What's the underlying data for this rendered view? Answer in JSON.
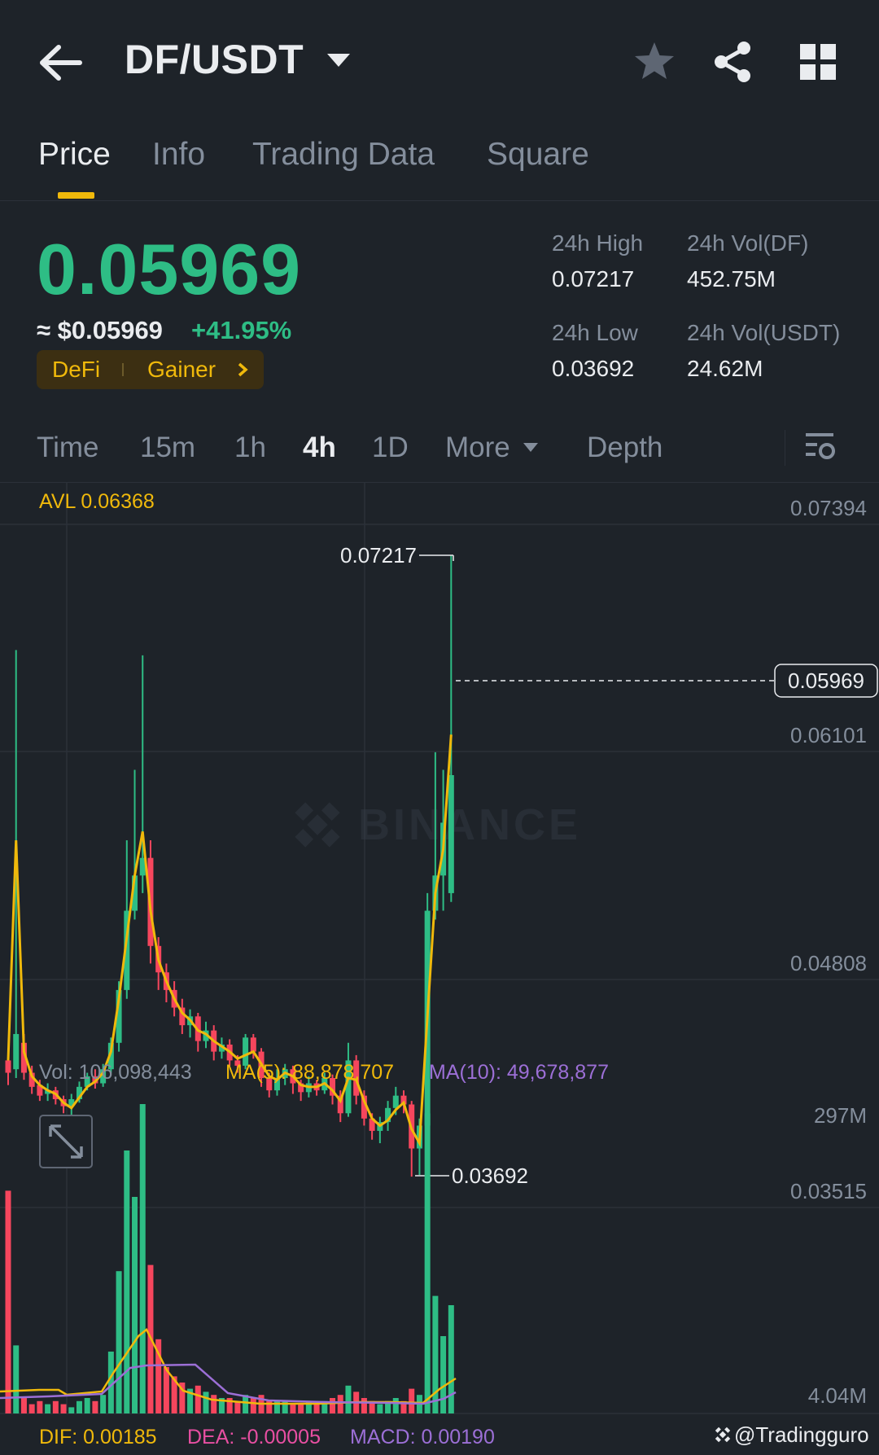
{
  "header": {
    "pair": "DF/USDT",
    "icons": [
      "back-arrow-icon",
      "star-icon",
      "share-icon",
      "grid-menu-icon"
    ]
  },
  "tabs": [
    {
      "label": "Price",
      "active": true
    },
    {
      "label": "Info",
      "active": false
    },
    {
      "label": "Trading Data",
      "active": false
    },
    {
      "label": "Square",
      "active": false
    }
  ],
  "price": {
    "last": "0.05969",
    "usd": "≈ $0.05969",
    "change": "+41.95%",
    "tag1": "DeFi",
    "tag2": "Gainer",
    "colors": {
      "up": "#2ebd85",
      "down": "#f6465d",
      "accent": "#f0b90b"
    }
  },
  "stats": {
    "high_label": "24h High",
    "high_value": "0.07217",
    "low_label": "24h Low",
    "low_value": "0.03692",
    "vol_df_label": "24h Vol(DF)",
    "vol_df_value": "452.75M",
    "vol_usdt_label": "24h Vol(USDT)",
    "vol_usdt_value": "24.62M"
  },
  "intervals": {
    "time": "Time",
    "m15": "15m",
    "h1": "1h",
    "h4": "4h",
    "d1": "1D",
    "more": "More",
    "depth": "Depth",
    "active": "4h"
  },
  "chart": {
    "avl": "AVL 0.06368",
    "y_ticks": [
      "0.07394",
      "0.06101",
      "0.04808",
      "0.03515"
    ],
    "current_price_tag": "0.05969",
    "high_marker": "0.07217",
    "low_marker": "0.03692",
    "watermark": "BINANCE",
    "vol_line": "Vol: 106,098,443",
    "ma5": "MA(5): 88,878,707",
    "ma10": "MA(10): 49,678,877",
    "vol_ticks": [
      "297M",
      "4.04M"
    ],
    "dif": "DIF: 0.00185",
    "dea": "DEA: -0.00005",
    "macd": "MACD: 0.00190",
    "credit": "@Tradingguro"
  },
  "chart_data": {
    "type": "candlestick",
    "interval": "4h",
    "y_axis_ticks": [
      0.07394,
      0.06101,
      0.04808,
      0.03515
    ],
    "ylim": [
      0.03515,
      0.07394
    ],
    "last_price": 0.05969,
    "high": 0.07217,
    "low": 0.03692,
    "candles": [
      {
        "o": 0.0435,
        "c": 0.0428,
        "h": 0.044,
        "l": 0.0421
      },
      {
        "o": 0.043,
        "c": 0.045,
        "h": 0.0668,
        "l": 0.0425
      },
      {
        "o": 0.0445,
        "c": 0.0428,
        "h": 0.045,
        "l": 0.0424
      },
      {
        "o": 0.0428,
        "c": 0.042,
        "h": 0.0432,
        "l": 0.0416
      },
      {
        "o": 0.0421,
        "c": 0.0415,
        "h": 0.0424,
        "l": 0.0412
      },
      {
        "o": 0.0416,
        "c": 0.0418,
        "h": 0.0422,
        "l": 0.0412
      },
      {
        "o": 0.0418,
        "c": 0.0413,
        "h": 0.042,
        "l": 0.041
      },
      {
        "o": 0.0413,
        "c": 0.0409,
        "h": 0.0415,
        "l": 0.0405
      },
      {
        "o": 0.0409,
        "c": 0.0413,
        "h": 0.0416,
        "l": 0.0404
      },
      {
        "o": 0.0413,
        "c": 0.042,
        "h": 0.0423,
        "l": 0.0411
      },
      {
        "o": 0.042,
        "c": 0.0426,
        "h": 0.0428,
        "l": 0.0418
      },
      {
        "o": 0.0426,
        "c": 0.0422,
        "h": 0.043,
        "l": 0.0419
      },
      {
        "o": 0.0422,
        "c": 0.043,
        "h": 0.0433,
        "l": 0.042
      },
      {
        "o": 0.043,
        "c": 0.0445,
        "h": 0.0448,
        "l": 0.0428
      },
      {
        "o": 0.0445,
        "c": 0.0475,
        "h": 0.048,
        "l": 0.044
      },
      {
        "o": 0.0475,
        "c": 0.052,
        "h": 0.056,
        "l": 0.047
      },
      {
        "o": 0.052,
        "c": 0.054,
        "h": 0.06,
        "l": 0.0515
      },
      {
        "o": 0.054,
        "c": 0.055,
        "h": 0.0665,
        "l": 0.053
      },
      {
        "o": 0.055,
        "c": 0.05,
        "h": 0.056,
        "l": 0.049
      },
      {
        "o": 0.05,
        "c": 0.0485,
        "h": 0.0505,
        "l": 0.0475
      },
      {
        "o": 0.0485,
        "c": 0.0475,
        "h": 0.049,
        "l": 0.0468
      },
      {
        "o": 0.0475,
        "c": 0.0465,
        "h": 0.048,
        "l": 0.046
      },
      {
        "o": 0.0465,
        "c": 0.0455,
        "h": 0.047,
        "l": 0.045
      },
      {
        "o": 0.0455,
        "c": 0.046,
        "h": 0.0464,
        "l": 0.0448
      },
      {
        "o": 0.046,
        "c": 0.0446,
        "h": 0.0462,
        "l": 0.044
      },
      {
        "o": 0.0446,
        "c": 0.0452,
        "h": 0.0457,
        "l": 0.0442
      },
      {
        "o": 0.0452,
        "c": 0.044,
        "h": 0.0455,
        "l": 0.0435
      },
      {
        "o": 0.044,
        "c": 0.0444,
        "h": 0.0448,
        "l": 0.0436
      },
      {
        "o": 0.0444,
        "c": 0.0435,
        "h": 0.0447,
        "l": 0.0432
      },
      {
        "o": 0.0435,
        "c": 0.0432,
        "h": 0.0438,
        "l": 0.0428
      },
      {
        "o": 0.0432,
        "c": 0.0448,
        "h": 0.045,
        "l": 0.043
      },
      {
        "o": 0.0448,
        "c": 0.044,
        "h": 0.045,
        "l": 0.0436
      },
      {
        "o": 0.044,
        "c": 0.0425,
        "h": 0.0442,
        "l": 0.042
      },
      {
        "o": 0.0425,
        "c": 0.0418,
        "h": 0.0428,
        "l": 0.0414
      },
      {
        "o": 0.0418,
        "c": 0.0425,
        "h": 0.043,
        "l": 0.0415
      },
      {
        "o": 0.0425,
        "c": 0.043,
        "h": 0.0433,
        "l": 0.0421
      },
      {
        "o": 0.043,
        "c": 0.0422,
        "h": 0.0432,
        "l": 0.0416
      },
      {
        "o": 0.0422,
        "c": 0.0417,
        "h": 0.0424,
        "l": 0.0412
      },
      {
        "o": 0.0417,
        "c": 0.0422,
        "h": 0.0426,
        "l": 0.0414
      },
      {
        "o": 0.0422,
        "c": 0.0418,
        "h": 0.0424,
        "l": 0.0415
      },
      {
        "o": 0.0418,
        "c": 0.0425,
        "h": 0.0428,
        "l": 0.0416
      },
      {
        "o": 0.0425,
        "c": 0.0415,
        "h": 0.0427,
        "l": 0.041
      },
      {
        "o": 0.0415,
        "c": 0.0405,
        "h": 0.0418,
        "l": 0.04
      },
      {
        "o": 0.0405,
        "c": 0.0435,
        "h": 0.0445,
        "l": 0.0403
      },
      {
        "o": 0.0435,
        "c": 0.0415,
        "h": 0.0438,
        "l": 0.041
      },
      {
        "o": 0.0415,
        "c": 0.0402,
        "h": 0.0418,
        "l": 0.0398
      },
      {
        "o": 0.0402,
        "c": 0.0395,
        "h": 0.0405,
        "l": 0.039
      },
      {
        "o": 0.0395,
        "c": 0.04,
        "h": 0.0403,
        "l": 0.0388
      },
      {
        "o": 0.04,
        "c": 0.0408,
        "h": 0.0412,
        "l": 0.0395
      },
      {
        "o": 0.0408,
        "c": 0.0415,
        "h": 0.042,
        "l": 0.0404
      },
      {
        "o": 0.0415,
        "c": 0.041,
        "h": 0.0418,
        "l": 0.0405
      },
      {
        "o": 0.041,
        "c": 0.0385,
        "h": 0.0412,
        "l": 0.0369
      },
      {
        "o": 0.0385,
        "c": 0.0398,
        "h": 0.0402,
        "l": 0.037
      },
      {
        "o": 0.0398,
        "c": 0.052,
        "h": 0.053,
        "l": 0.0395
      },
      {
        "o": 0.052,
        "c": 0.054,
        "h": 0.061,
        "l": 0.0515
      },
      {
        "o": 0.054,
        "c": 0.057,
        "h": 0.06,
        "l": 0.052
      },
      {
        "o": 0.053,
        "c": 0.0597,
        "h": 0.07217,
        "l": 0.0525
      }
    ],
    "ma_line": [
      0.0435,
      0.056,
      0.044,
      0.0426,
      0.0421,
      0.0418,
      0.0416,
      0.0411,
      0.0408,
      0.0414,
      0.042,
      0.0423,
      0.0428,
      0.044,
      0.047,
      0.0505,
      0.054,
      0.0565,
      0.052,
      0.0492,
      0.048,
      0.047,
      0.0462,
      0.0458,
      0.0452,
      0.045,
      0.0446,
      0.0443,
      0.044,
      0.0436,
      0.0438,
      0.044,
      0.0433,
      0.0426,
      0.0424,
      0.0428,
      0.0426,
      0.0421,
      0.042,
      0.042,
      0.0422,
      0.0418,
      0.0412,
      0.0425,
      0.0424,
      0.0412,
      0.0402,
      0.0398,
      0.0401,
      0.0407,
      0.0411,
      0.0396,
      0.0388,
      0.046,
      0.053,
      0.0555,
      0.062
    ],
    "volume_ma_series": [
      {
        "name": "MA(5)"
      },
      {
        "name": "MA(10)"
      }
    ]
  }
}
